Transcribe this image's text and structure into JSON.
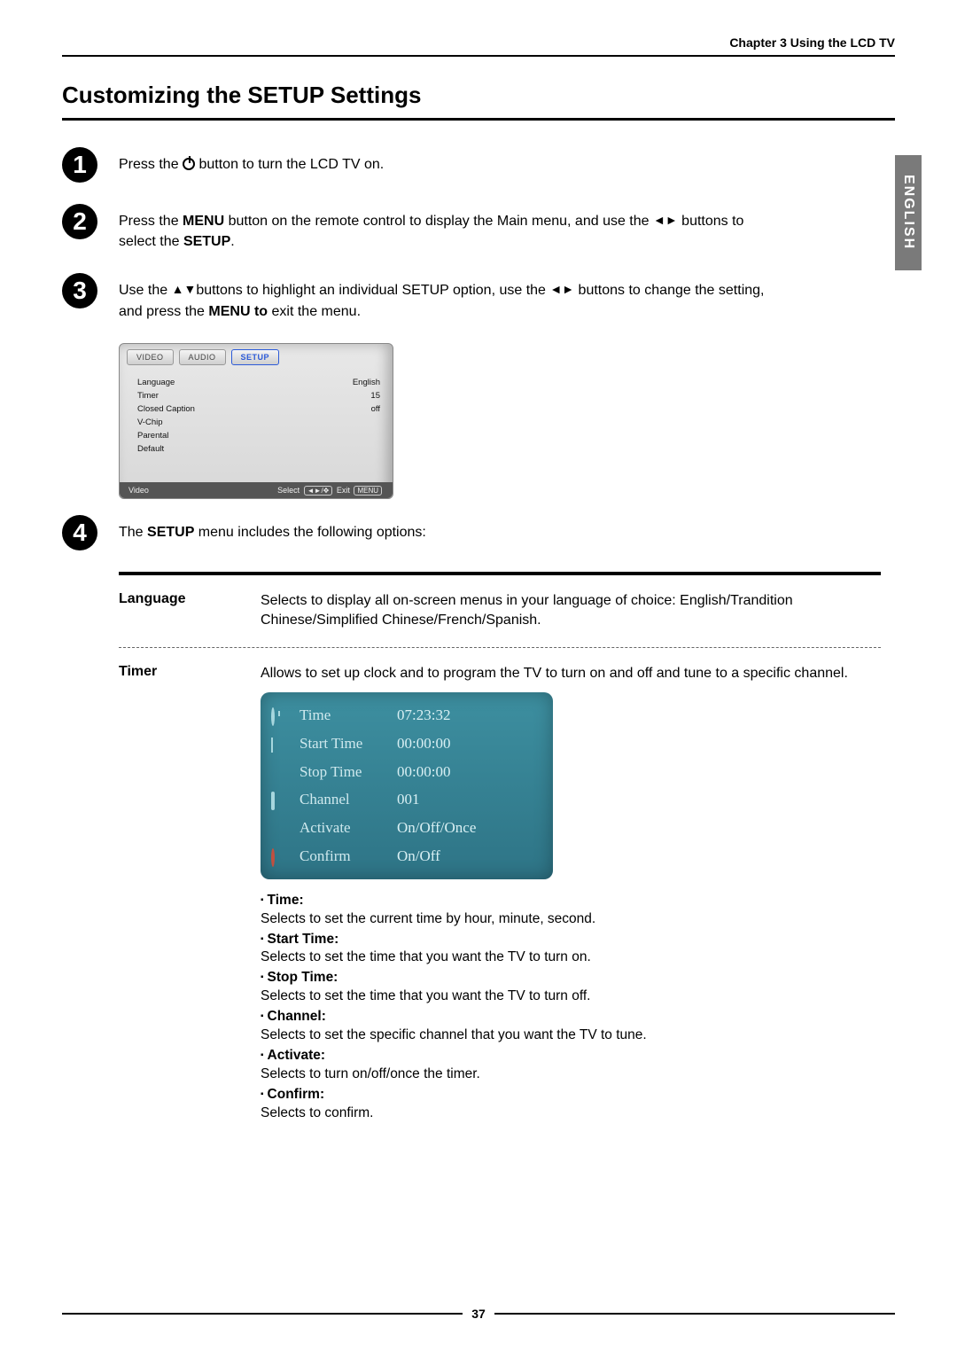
{
  "chapter": "Chapter 3 Using the LCD TV",
  "title": "Customizing the SETUP Settings",
  "side_tab": "ENGLISH",
  "steps": [
    {
      "num": "1",
      "pre": "Press the ",
      "post": " button to turn the LCD TV on."
    },
    {
      "num": "2",
      "t1": "Press the ",
      "bold1": "MENU",
      "t2": " button on the remote control to display the Main menu, and use the ",
      "arrows": "◄►",
      "t3": " buttons to select the ",
      "bold2": "SETUP",
      "t4": "."
    },
    {
      "num": "3",
      "t1": "Use the  ",
      "ud": "▲▼",
      "t2": "buttons to highlight an individual SETUP option, use the ",
      "lr": "◄►",
      "t3": " buttons to change the setting, and press the ",
      "bold": "MENU to",
      "t4": " exit the menu."
    },
    {
      "num": "4",
      "t1": "The ",
      "bold": "SETUP",
      "t2": " menu includes the following options:"
    }
  ],
  "osd": {
    "tabs": [
      "VIDEO",
      "AUDIO",
      "SETUP"
    ],
    "rows": [
      {
        "l": "Language",
        "v": "English"
      },
      {
        "l": "Timer",
        "v": "15"
      },
      {
        "l": "Closed Caption",
        "v": "off"
      },
      {
        "l": "V-Chip",
        "v": ""
      },
      {
        "l": "Parental",
        "v": ""
      },
      {
        "l": "Default",
        "v": ""
      }
    ],
    "footer_left": "Video",
    "footer_select": "Select",
    "footer_nav": "◄►/✥",
    "footer_exit": "Exit",
    "footer_menu": "MENU"
  },
  "options": {
    "language": {
      "label": "Language",
      "desc": "Selects to display all on-screen menus in your language of choice: English/Trandition Chinese/Simplified Chinese/French/Spanish."
    },
    "timer": {
      "label": "Timer",
      "desc": "Allows to set up clock and to program the TV to turn on and off and tune to a specific channel.",
      "rows": [
        {
          "l": "Time",
          "v": "07:23:32"
        },
        {
          "l": "Start Time",
          "v": "00:00:00"
        },
        {
          "l": "Stop Time",
          "v": "00:00:00"
        },
        {
          "l": "Channel",
          "v": "001"
        },
        {
          "l": "Activate",
          "v": "On/Off/Once"
        },
        {
          "l": "Confirm",
          "v": "On/Off"
        }
      ],
      "bullets": [
        {
          "t": "Time:",
          "d": "Selects to set the current time by hour, minute, second."
        },
        {
          "t": "Start Time:",
          "d": "Selects to set the time that you want the TV to turn on."
        },
        {
          "t": "Stop Time:",
          "d": "Selects to set the time that you want the TV to turn off."
        },
        {
          "t": "Channel:",
          "d": "Selects to set the specific channel that you want the TV to tune."
        },
        {
          "t": "Activate:",
          "d": "Selects to turn on/off/once the timer."
        },
        {
          "t": "Confirm:",
          "d": "Selects to confirm."
        }
      ]
    }
  },
  "page_number": "37"
}
